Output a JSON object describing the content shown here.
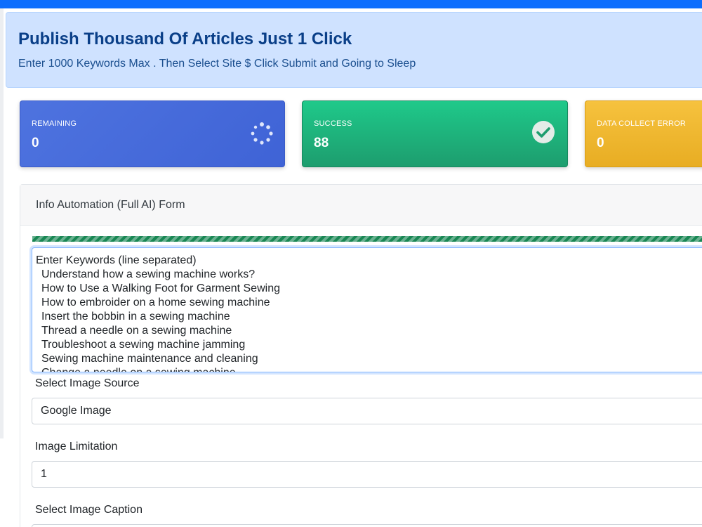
{
  "hero": {
    "title": "Publish Thousand Of Articles Just 1 Click",
    "subtitle": "Enter 1000 Keywords Max . Then Select Site $ Click Submit and Going to Sleep"
  },
  "stats": {
    "remaining": {
      "label": "REMAINING",
      "value": "0",
      "icon": "spinner-icon",
      "color": "#4e73df"
    },
    "success": {
      "label": "SUCCESS",
      "value": "88",
      "icon": "check-circle-icon",
      "color": "#1cc88a"
    },
    "error": {
      "label": "DATA COLLECT ERROR",
      "value": "0",
      "color": "#f6c23e"
    }
  },
  "form": {
    "title": "Info Automation (Full AI) Form",
    "progress_percent": 100,
    "keywords": {
      "header": "Enter Keywords (line separated)",
      "lines": [
        "Understand how a sewing machine works?",
        "How to Use a Walking Foot for Garment Sewing",
        "How to embroider on a home sewing machine",
        "Insert the bobbin in a sewing machine",
        "Thread a needle on a sewing machine",
        "Troubleshoot a sewing machine jamming",
        "Sewing machine maintenance and cleaning",
        "Change a needle on a sewing machine"
      ]
    },
    "image_source": {
      "label": "Select Image Source",
      "value": "Google Image"
    },
    "image_limit": {
      "label": "Image Limitation",
      "value": "1"
    },
    "image_caption": {
      "label": "Select Image Caption"
    }
  }
}
